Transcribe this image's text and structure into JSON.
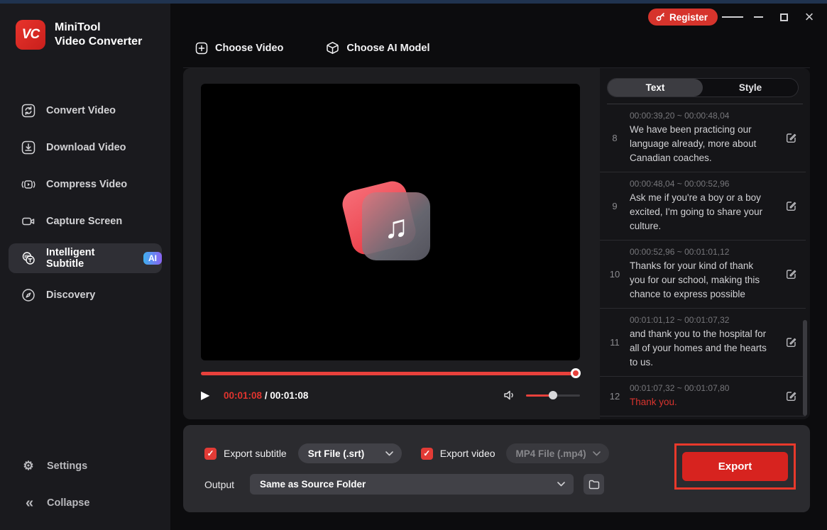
{
  "window": {
    "register_label": "Register"
  },
  "sidebar": {
    "brand": {
      "logo_text": "VC",
      "title_line1": "MiniTool",
      "title_line2": "Video Converter"
    },
    "items": [
      {
        "label": "Convert Video"
      },
      {
        "label": "Download Video"
      },
      {
        "label": "Compress Video"
      },
      {
        "label": "Capture Screen"
      },
      {
        "label": "Intelligent Subtitle",
        "badge": "AI"
      },
      {
        "label": "Discovery"
      }
    ],
    "footer": {
      "settings_label": "Settings",
      "collapse_label": "Collapse"
    }
  },
  "steps": [
    {
      "label": "Choose Video"
    },
    {
      "label": "Choose AI Model"
    }
  ],
  "player": {
    "current_time": "00:01:08",
    "separator": "/",
    "total_time": "00:01:08"
  },
  "subtitle_panel": {
    "tabs": [
      {
        "label": "Text"
      },
      {
        "label": "Style"
      }
    ],
    "entries": [
      {
        "index": "8",
        "time": "00:00:39,20 ~ 00:00:48,04",
        "text": "We have been practicing our language already, more about Canadian coaches."
      },
      {
        "index": "9",
        "time": "00:00:48,04 ~ 00:00:52,96",
        "text": "Ask me if you're a boy or a boy excited, I'm going to share your culture."
      },
      {
        "index": "10",
        "time": "00:00:52,96 ~ 00:01:01,12",
        "text": "Thanks for your kind of thank you for our school, making this chance to express possible"
      },
      {
        "index": "11",
        "time": "00:01:01,12 ~ 00:01:07,32",
        "text": "and thank you to the hospital for all of your homes and the hearts to us."
      },
      {
        "index": "12",
        "time": "00:01:07,32 ~ 00:01:07,80",
        "text": "Thank you."
      }
    ]
  },
  "export_bar": {
    "export_subtitle_label": "Export subtitle",
    "subtitle_format_value": "Srt File (.srt)",
    "export_video_label": "Export video",
    "video_format_value": "MP4 File (.mp4)",
    "output_label": "Output",
    "output_value": "Same as Source Folder",
    "export_button_label": "Export"
  },
  "icons": {
    "check_glyph": "✓",
    "play_glyph": "▶",
    "note_glyph": "♫",
    "settings_glyph": "⚙",
    "collapse_glyph": "«",
    "close_glyph": "×"
  },
  "colors": {
    "accent_red": "#d7231f",
    "progress_red": "#e8413c",
    "highlight_subtitle_red": "#d9342e",
    "ai_badge_gradient": [
      "#3fb0f0",
      "#8a63f2"
    ],
    "sidebar_bg": "#1a1a1e",
    "card_bg": "#1d1d20",
    "export_bar_bg": "#2b2b2f"
  }
}
